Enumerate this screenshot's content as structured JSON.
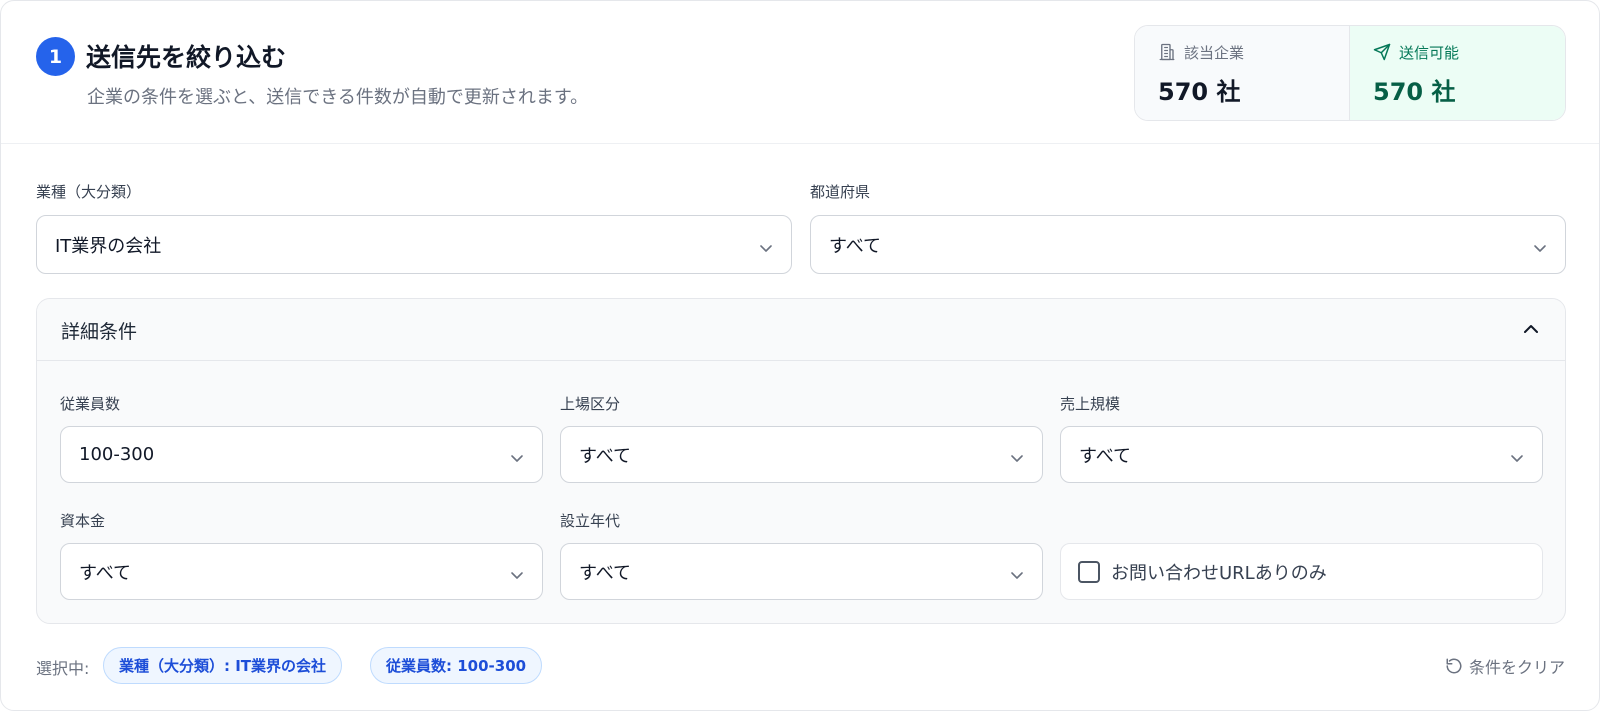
{
  "header": {
    "step": "1",
    "title": "送信先を絞り込む",
    "subtitle": "企業の条件を選ぶと、送信できる件数が自動で更新されます。"
  },
  "stats": {
    "matched": {
      "label": "該当企業",
      "value": "570 社",
      "icon": "building-icon"
    },
    "sendable": {
      "label": "送信可能",
      "value": "570 社",
      "icon": "send-icon"
    }
  },
  "filters": {
    "industry": {
      "label": "業種（大分類）",
      "value": "IT業界の会社"
    },
    "prefecture": {
      "label": "都道府県",
      "value": "すべて"
    }
  },
  "details": {
    "title": "詳細条件",
    "expanded": true,
    "employees": {
      "label": "従業員数",
      "value": "100-300"
    },
    "listing": {
      "label": "上場区分",
      "value": "すべて"
    },
    "sales": {
      "label": "売上規模",
      "value": "すべて"
    },
    "capital": {
      "label": "資本金",
      "value": "すべて"
    },
    "founded": {
      "label": "設立年代",
      "value": "すべて"
    },
    "contact_url_only": {
      "label": "お問い合わせURLありのみ",
      "checked": false
    }
  },
  "selection": {
    "label": "選択中:",
    "chips": [
      "業種（大分類）: IT業界の会社",
      "従業員数: 100-300"
    ],
    "clear_label": "条件をクリア"
  },
  "colors": {
    "accent": "#2563eb",
    "sendable_bg": "#ecfdf5",
    "sendable_text": "#065f46",
    "chip_bg": "#eff6ff",
    "chip_text": "#1d4ed8"
  }
}
